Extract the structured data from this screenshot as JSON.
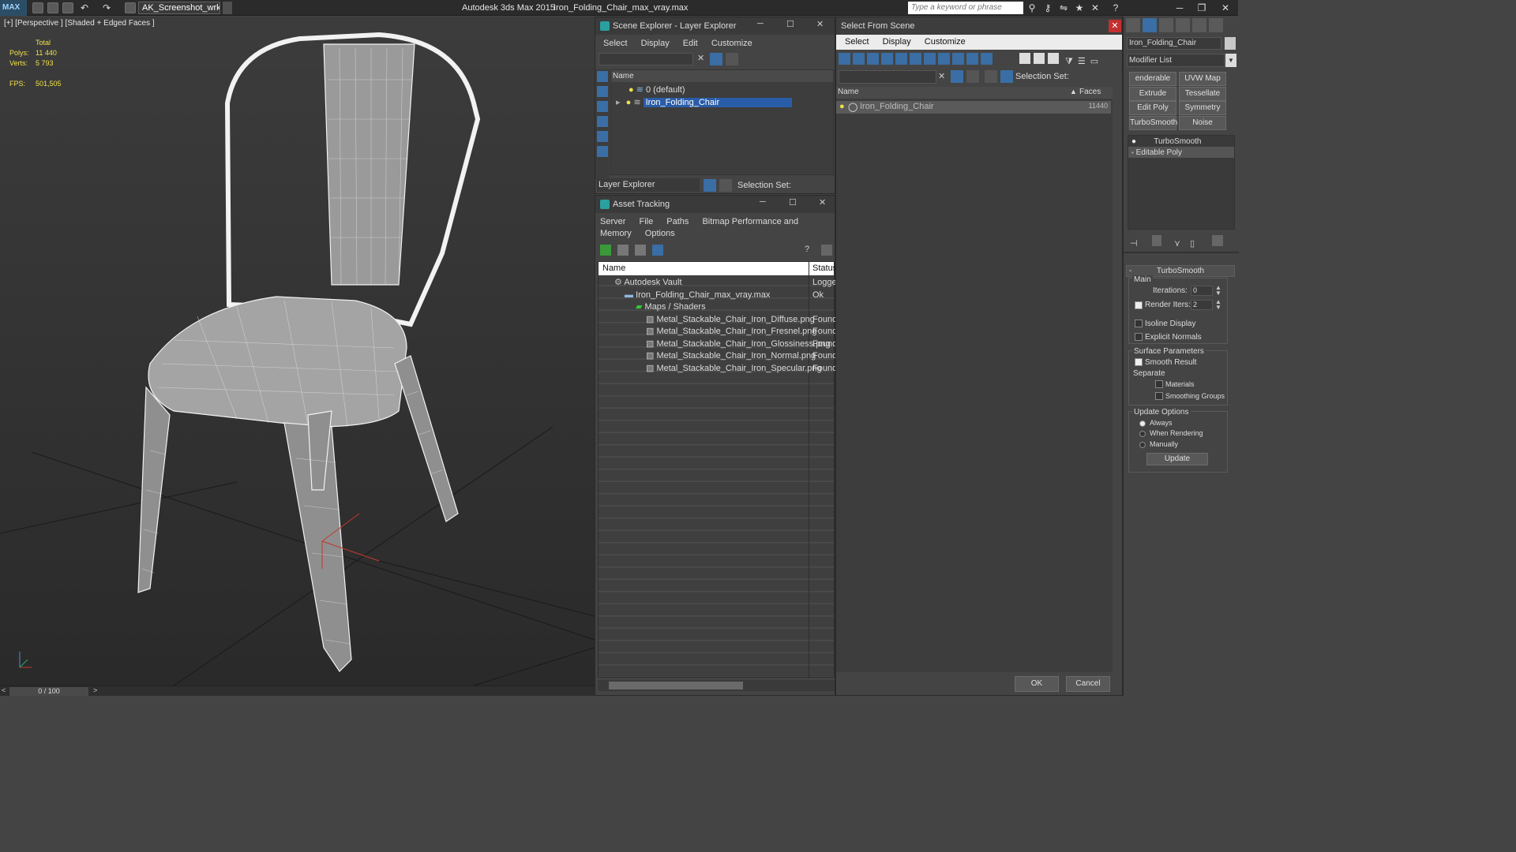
{
  "titlebar": {
    "logo": "MAX",
    "workspace": "AK_Screenshot_wrksp",
    "app_title": "Autodesk 3ds Max  2015",
    "file_title": "Iron_Folding_Chair_max_vray.max",
    "search_placeholder": "Type a keyword or phrase"
  },
  "viewport": {
    "label": "[+] [Perspective ] [Shaded + Edged Faces ]",
    "stats_header": "Total",
    "polys_label": "Polys:",
    "polys_value": "11 440",
    "verts_label": "Verts:",
    "verts_value": "5 793",
    "fps_label": "FPS:",
    "fps_value": "501,505"
  },
  "timeline": {
    "value": "0 / 100"
  },
  "scene_explorer": {
    "title": "Scene Explorer - Layer Explorer",
    "menu": [
      "Select",
      "Display",
      "Edit",
      "Customize"
    ],
    "column_name": "Name",
    "layers": [
      "0 (default)",
      "Iron_Folding_Chair"
    ],
    "footer_dropdown": "Layer Explorer",
    "selection_set_label": "Selection Set:"
  },
  "asset_tracking": {
    "title": "Asset Tracking",
    "menu": [
      "Server",
      "File",
      "Paths",
      "Bitmap Performance and Memory",
      "Options"
    ],
    "col_name": "Name",
    "col_status": "Status",
    "rows": [
      {
        "name": "Autodesk Vault",
        "status": "Logge"
      },
      {
        "name": "Iron_Folding_Chair_max_vray.max",
        "status": "Ok"
      },
      {
        "name": "Maps / Shaders",
        "status": ""
      },
      {
        "name": "Metal_Stackable_Chair_Iron_Diffuse.png",
        "status": "Found"
      },
      {
        "name": "Metal_Stackable_Chair_Iron_Fresnel.png",
        "status": "Found"
      },
      {
        "name": "Metal_Stackable_Chair_Iron_Glossiness.png",
        "status": "Found"
      },
      {
        "name": "Metal_Stackable_Chair_Iron_Normal.png",
        "status": "Found"
      },
      {
        "name": "Metal_Stackable_Chair_Iron_Specular.png",
        "status": "Found"
      }
    ]
  },
  "select_from_scene": {
    "title": "Select From Scene",
    "menu": [
      "Select",
      "Display",
      "Customize"
    ],
    "selection_set_label": "Selection Set:",
    "col_name": "Name",
    "col_faces": "Faces",
    "object_name": "Iron_Folding_Chair",
    "object_faces": "11440",
    "ok": "OK",
    "cancel": "Cancel"
  },
  "modify_panel": {
    "object_name": "Iron_Folding_Chair",
    "modifier_list": "Modifier List",
    "buttons": [
      "enderable Spli",
      "UVW Map",
      "Extrude",
      "Tessellate",
      "Edit Poly",
      "Symmetry",
      "TurboSmooth",
      "Noise"
    ],
    "stack": [
      "TurboSmooth",
      "Editable Poly"
    ],
    "rollout_title": "TurboSmooth",
    "main_label": "Main",
    "iterations_label": "Iterations:",
    "iterations_value": "0",
    "render_iters_label": "Render Iters:",
    "render_iters_value": "2",
    "isoline": "Isoline Display",
    "explicit_normals": "Explicit Normals",
    "surface_params": "Surface Parameters",
    "smooth_result": "Smooth Result",
    "separate": "Separate",
    "materials": "Materials",
    "smoothing_groups": "Smoothing Groups",
    "update_options": "Update Options",
    "always": "Always",
    "when_rendering": "When Rendering",
    "manually": "Manually",
    "update": "Update"
  }
}
